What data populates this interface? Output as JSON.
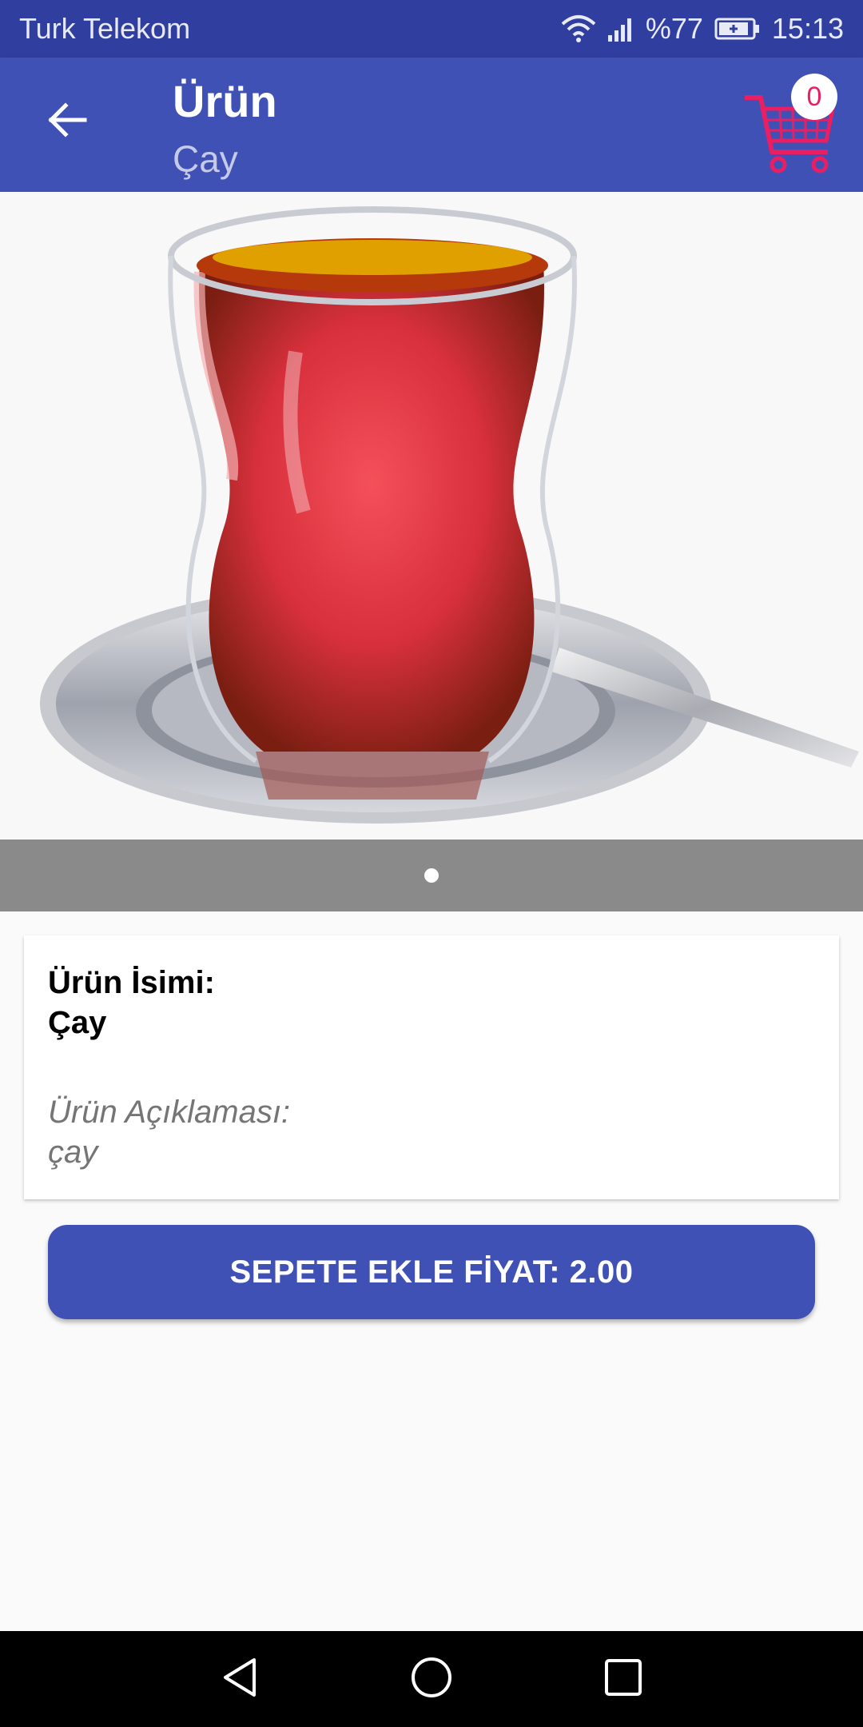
{
  "status_bar": {
    "carrier": "Turk Telekom",
    "battery": "%77",
    "time": "15:13",
    "icons": [
      "wifi-icon",
      "signal-icon",
      "battery-charging-icon"
    ]
  },
  "app_bar": {
    "title": "Ürün",
    "subtitle": "Çay",
    "back_icon": "arrow-back-icon",
    "cart_icon": "shopping-cart-icon",
    "cart_count": "0"
  },
  "product_image": {
    "subject": "tea-glass-image",
    "page_index": 1,
    "page_count": 1
  },
  "info_card": {
    "name_label": "Ürün İsimi:",
    "name_value": "Çay",
    "description_label": "Ürün Açıklaması:",
    "description_value": "çay"
  },
  "add_button": {
    "label": "SEPETE EKLE FİYAT: 2.00"
  },
  "nav_bar": {
    "icons": [
      "nav-back-icon",
      "nav-home-icon",
      "nav-recents-icon"
    ]
  },
  "colors": {
    "status_bar": "#303f9f",
    "primary": "#3f51b5",
    "accent": "#e91e63",
    "pager_strip": "#8a8a8a"
  }
}
